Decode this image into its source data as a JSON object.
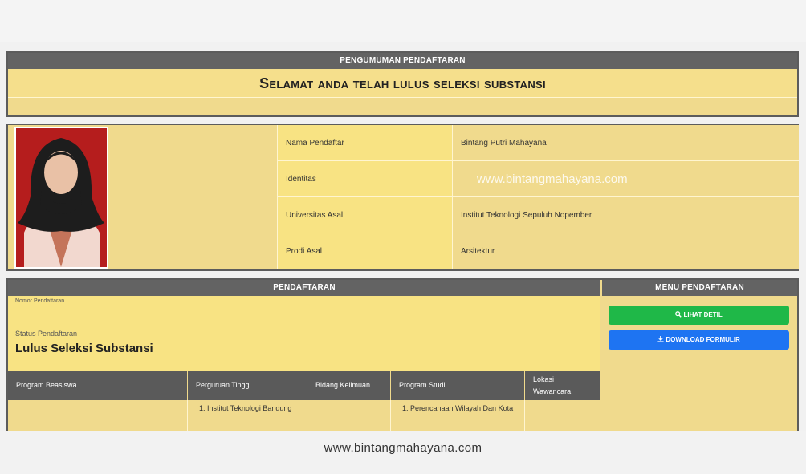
{
  "announcement": {
    "header": "PENGUMUMAN PENDAFTARAN",
    "message": "Selamat anda telah lulus seleksi substansi"
  },
  "profile": {
    "rows": [
      {
        "label": "Nama Pendaftar",
        "value": "Bintang Putri Mahayana"
      },
      {
        "label": "Identitas",
        "value": "www.bintangmahayana.com"
      },
      {
        "label": "Universitas Asal",
        "value": "Institut Teknologi Sepuluh Nopember"
      },
      {
        "label": "Prodi Asal",
        "value": "Arsitektur"
      }
    ]
  },
  "registration": {
    "header": "PENDAFTARAN",
    "number_label": "Nomor Pendaftaran",
    "status_label": "Status Pendaftaran",
    "status_value": "Lulus Seleksi Substansi",
    "columns": [
      "Program Beasiswa",
      "Perguruan Tinggi",
      "Bidang Keilmuan",
      "Program Studi",
      "Lokasi Wawancara"
    ],
    "row": {
      "program_beasiswa": "",
      "perguruan_tinggi": "Institut Teknologi Bandung",
      "bidang_keilmuan": "",
      "program_studi": "Perencanaan Wilayah Dan Kota",
      "lokasi_wawancara": ""
    }
  },
  "menu": {
    "header": "MENU PENDAFTARAN",
    "detail_label": "LIHAT DETIL",
    "download_label": "DOWNLOAD FORMULIR"
  },
  "footer": {
    "text": "www.bintangmahayana.com"
  },
  "colors": {
    "panel": "#f0da8d",
    "header": "#636363",
    "green": "#1fb848",
    "blue": "#1e74f2"
  },
  "icons": {
    "detail": "search-icon",
    "download": "download-icon"
  }
}
